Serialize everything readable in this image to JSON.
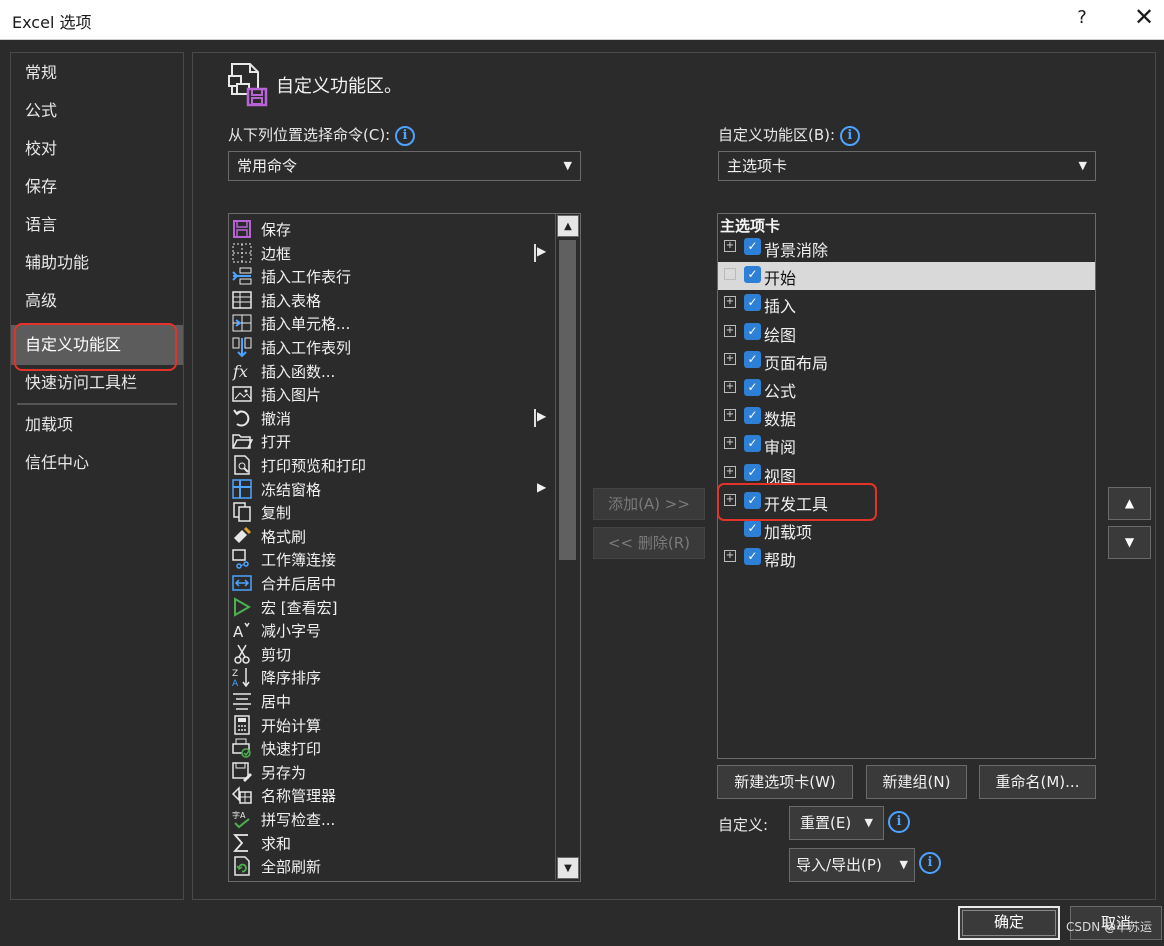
{
  "window": {
    "title": "Excel 选项",
    "help": "?",
    "close": "✕"
  },
  "nav": {
    "items": [
      {
        "label": "常规"
      },
      {
        "label": "公式"
      },
      {
        "label": "校对"
      },
      {
        "label": "保存"
      },
      {
        "label": "语言"
      },
      {
        "label": "辅助功能"
      },
      {
        "label": "高级"
      },
      {
        "label": "自定义功能区"
      },
      {
        "label": "快速访问工具栏"
      },
      {
        "label": "加载项"
      },
      {
        "label": "信任中心"
      }
    ],
    "active_index": 7
  },
  "header": {
    "title": "自定义功能区。"
  },
  "left": {
    "label": "从下列位置选择命令(C):",
    "dropdown_value": "常用命令",
    "commands": [
      {
        "label": "保存",
        "icon": "save-icon",
        "submenu": false
      },
      {
        "label": "边框",
        "icon": "border-icon",
        "submenu": true
      },
      {
        "label": "插入工作表行",
        "icon": "insert-row-icon",
        "submenu": false
      },
      {
        "label": "插入表格",
        "icon": "insert-table-icon",
        "submenu": false
      },
      {
        "label": "插入单元格...",
        "icon": "insert-cells-icon",
        "submenu": false
      },
      {
        "label": "插入工作表列",
        "icon": "insert-column-icon",
        "submenu": false
      },
      {
        "label": "插入函数...",
        "icon": "function-icon",
        "submenu": false
      },
      {
        "label": "插入图片",
        "icon": "picture-icon",
        "submenu": false
      },
      {
        "label": "撤消",
        "icon": "undo-icon",
        "submenu": true
      },
      {
        "label": "打开",
        "icon": "open-folder-icon",
        "submenu": false
      },
      {
        "label": "打印预览和打印",
        "icon": "print-preview-icon",
        "submenu": false
      },
      {
        "label": "冻结窗格",
        "icon": "freeze-panes-icon",
        "submenu": "arrow"
      },
      {
        "label": "复制",
        "icon": "copy-icon",
        "submenu": false
      },
      {
        "label": "格式刷",
        "icon": "format-painter-icon",
        "submenu": false
      },
      {
        "label": "工作簿连接",
        "icon": "connections-icon",
        "submenu": false
      },
      {
        "label": "合并后居中",
        "icon": "merge-center-icon",
        "submenu": false
      },
      {
        "label": "宏 [查看宏]",
        "icon": "macro-play-icon",
        "submenu": false
      },
      {
        "label": "减小字号",
        "icon": "decrease-font-icon",
        "submenu": false
      },
      {
        "label": "剪切",
        "icon": "cut-icon",
        "submenu": false
      },
      {
        "label": "降序排序",
        "icon": "sort-desc-icon",
        "submenu": false
      },
      {
        "label": "居中",
        "icon": "align-center-icon",
        "submenu": false
      },
      {
        "label": "开始计算",
        "icon": "calculator-icon",
        "submenu": false
      },
      {
        "label": "快速打印",
        "icon": "quick-print-icon",
        "submenu": false
      },
      {
        "label": "另存为",
        "icon": "save-as-icon",
        "submenu": false
      },
      {
        "label": "名称管理器",
        "icon": "name-manager-icon",
        "submenu": false
      },
      {
        "label": "拼写检查...",
        "icon": "spelling-icon",
        "submenu": false
      },
      {
        "label": "求和",
        "icon": "sum-icon",
        "submenu": false
      },
      {
        "label": "全部刷新",
        "icon": "refresh-all-icon",
        "submenu": false
      }
    ]
  },
  "middle": {
    "add_label": "添加(A) >>",
    "remove_label": "<< 删除(R)"
  },
  "right": {
    "label": "自定义功能区(B):",
    "dropdown_value": "主选项卡",
    "tree_header": "主选项卡",
    "tabs": [
      {
        "label": "背景消除",
        "expandable": true,
        "checked": true
      },
      {
        "label": "开始",
        "expandable": true,
        "checked": true,
        "selected": true
      },
      {
        "label": "插入",
        "expandable": true,
        "checked": true
      },
      {
        "label": "绘图",
        "expandable": true,
        "checked": true
      },
      {
        "label": "页面布局",
        "expandable": true,
        "checked": true
      },
      {
        "label": "公式",
        "expandable": true,
        "checked": true
      },
      {
        "label": "数据",
        "expandable": true,
        "checked": true
      },
      {
        "label": "审阅",
        "expandable": true,
        "checked": true
      },
      {
        "label": "视图",
        "expandable": true,
        "checked": true
      },
      {
        "label": "开发工具",
        "expandable": true,
        "checked": true
      },
      {
        "label": "加载项",
        "expandable": false,
        "checked": true
      },
      {
        "label": "帮助",
        "expandable": true,
        "checked": true
      }
    ],
    "new_tab_label": "新建选项卡(W)",
    "new_group_label": "新建组(N)",
    "rename_label": "重命名(M)...",
    "customize_label": "自定义:",
    "reset_label": "重置(E)",
    "import_export_label": "导入/导出(P)"
  },
  "footer": {
    "ok_label": "确定",
    "cancel_label": "取消"
  },
  "watermark": "CSDN @辛苏运",
  "colors": {
    "accent": "#2e7fd6",
    "highlight": "#e0342a",
    "background": "#2b2b2b"
  }
}
